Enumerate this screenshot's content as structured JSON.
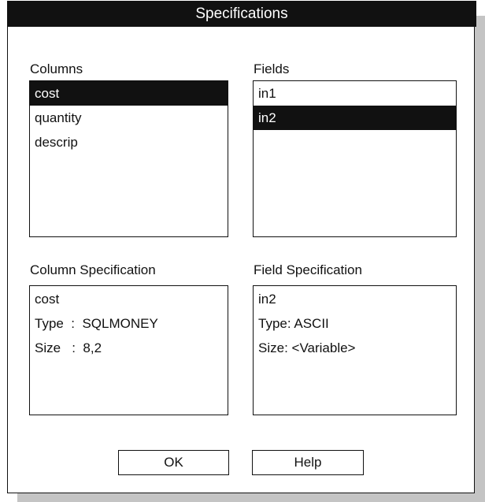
{
  "dialog": {
    "title": "Specifications"
  },
  "columns": {
    "label": "Columns",
    "items": [
      "cost",
      "quantity",
      "descrip"
    ],
    "selected": "cost"
  },
  "fields": {
    "label": "Fields",
    "items": [
      "in1",
      "in2"
    ],
    "selected": "in2"
  },
  "column_spec": {
    "label": "Column Specification",
    "lines": [
      "cost",
      "Type  :  SQLMONEY",
      "Size   :  8,2"
    ]
  },
  "field_spec": {
    "label": "Field Specification",
    "lines": [
      "in2",
      "Type: ASCII",
      "Size: <Variable>"
    ]
  },
  "buttons": {
    "ok": "OK",
    "help": "Help"
  },
  "colors": {
    "selection": "#111111",
    "shadow": "#c4c4c4"
  }
}
